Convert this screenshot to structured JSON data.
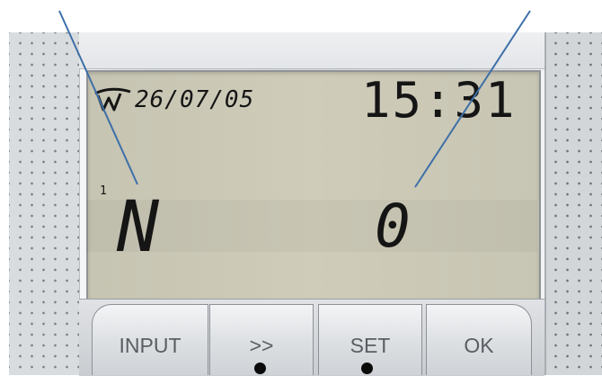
{
  "display": {
    "date": "26/07/05",
    "time": "15:31",
    "line_number": "1",
    "left_value": "N",
    "right_value": "0"
  },
  "buttons": {
    "input_label": "INPUT",
    "next_label": ">>",
    "set_label": "SET",
    "ok_label": "OK"
  },
  "colors": {
    "lcd_background": "#cbc9b6",
    "segment_text": "#151515",
    "pointer_line": "#3d6fa8",
    "button_text": "#5a5d62"
  },
  "icons": {
    "logo": "wave-logo-icon"
  }
}
